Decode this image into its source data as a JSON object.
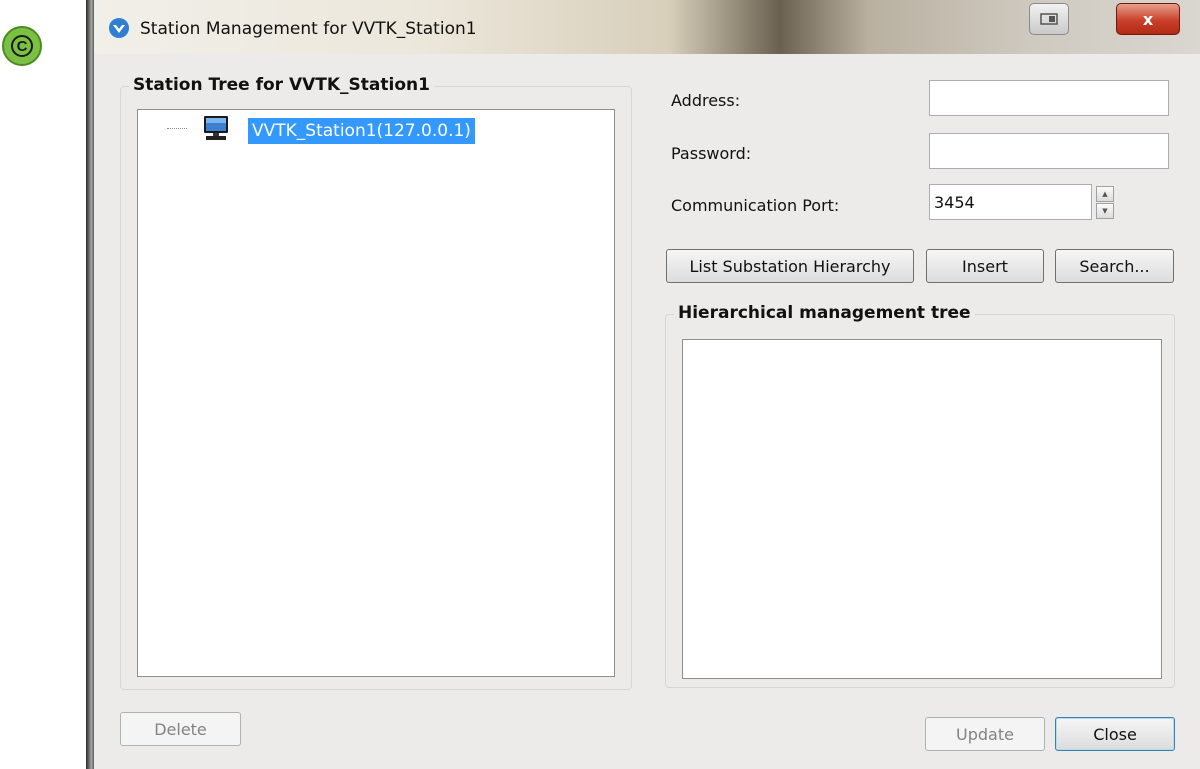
{
  "badge": {
    "letter": "C"
  },
  "window": {
    "title": "Station Management for VVTK_Station1",
    "close_glyph": "x"
  },
  "station_tree": {
    "title": "Station Tree for VVTK_Station1",
    "nodes": [
      {
        "label": "VVTK_Station1(127.0.0.1)",
        "selected": true,
        "icon": "computer-icon"
      }
    ]
  },
  "form": {
    "address_label": "Address:",
    "address_value": "",
    "password_label": "Password:",
    "password_value": "",
    "port_label": "Communication Port:",
    "port_value": "3454"
  },
  "buttons": {
    "list_hierarchy": "List Substation Hierarchy",
    "insert": "Insert",
    "search": "Search...",
    "delete": "Delete",
    "update": "Update",
    "close": "Close"
  },
  "hierarchy_tree": {
    "title": "Hierarchical management tree",
    "nodes": []
  },
  "colors": {
    "selection": "#3399ff",
    "badge_green": "#7ac143",
    "window_bg": "#ecebea"
  }
}
